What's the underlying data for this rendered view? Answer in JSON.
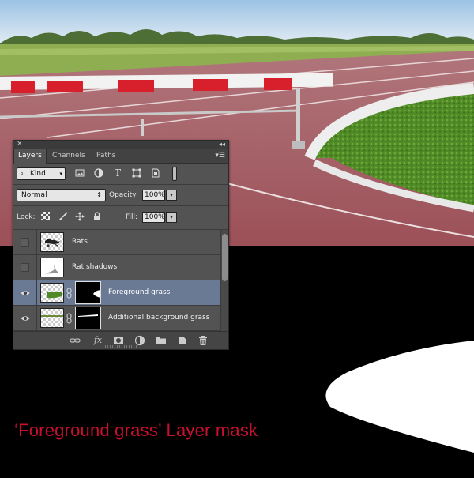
{
  "caption": "‘Foreground grass’ Layer mask",
  "panel": {
    "close_glyph": "×",
    "collapse_glyph": "◂◂",
    "tabs": [
      {
        "label": "Layers",
        "active": true
      },
      {
        "label": "Channels",
        "active": false
      },
      {
        "label": "Paths",
        "active": false
      }
    ],
    "menu_glyph": "▾☰",
    "filter": {
      "selected": "Kind",
      "icons": [
        "image-filter-icon",
        "adjustment-filter-icon",
        "type-filter-icon",
        "shape-filter-icon",
        "smart-object-filter-icon"
      ]
    },
    "blend_mode": "Normal",
    "opacity_label": "Opacity:",
    "opacity_value": "100%",
    "lock_label": "Lock:",
    "fill_label": "Fill:",
    "fill_value": "100%",
    "layers": [
      {
        "name": "Rats",
        "visible": false,
        "selected": false,
        "has_mask": false
      },
      {
        "name": "Rat shadows",
        "visible": false,
        "selected": false,
        "has_mask": false
      },
      {
        "name": "Foreground grass",
        "visible": true,
        "selected": true,
        "has_mask": true
      },
      {
        "name": "Additional background grass",
        "visible": true,
        "selected": false,
        "has_mask": true
      }
    ],
    "bottom_icons": [
      "link-layers-icon",
      "fx-icon",
      "add-mask-icon",
      "adjustment-layer-icon",
      "new-group-icon",
      "new-layer-icon",
      "delete-layer-icon"
    ],
    "fx_label": "fx"
  },
  "colors": {
    "caption": "#c8102e",
    "panel_bg": "#535353",
    "selected_row": "#6a7a95"
  }
}
